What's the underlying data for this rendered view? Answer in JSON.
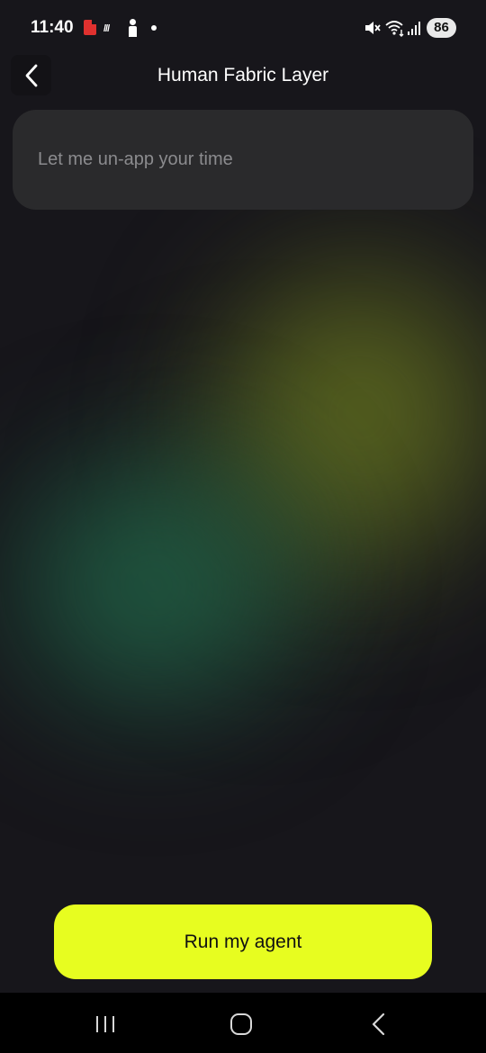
{
  "status_bar": {
    "time": "11:40",
    "stripes_glyph": "///",
    "battery": "86",
    "icons": [
      "pdf-notification-icon",
      "stripes-icon",
      "person-icon",
      "dot-icon",
      "mute-icon",
      "wifi-icon",
      "signal-icon"
    ]
  },
  "header": {
    "back_icon": "chevron-left-icon",
    "title": "Human Fabric Layer"
  },
  "prompt": {
    "placeholder": "Let me un-app your time"
  },
  "cta": {
    "label": "Run my agent",
    "color": "#e7fd20"
  },
  "nav_bar": {
    "icons": [
      "recent-apps-icon",
      "home-icon",
      "back-icon"
    ]
  },
  "colors": {
    "background": "#17161b",
    "card": "#2a2a2c",
    "accent": "#e7fd20"
  }
}
